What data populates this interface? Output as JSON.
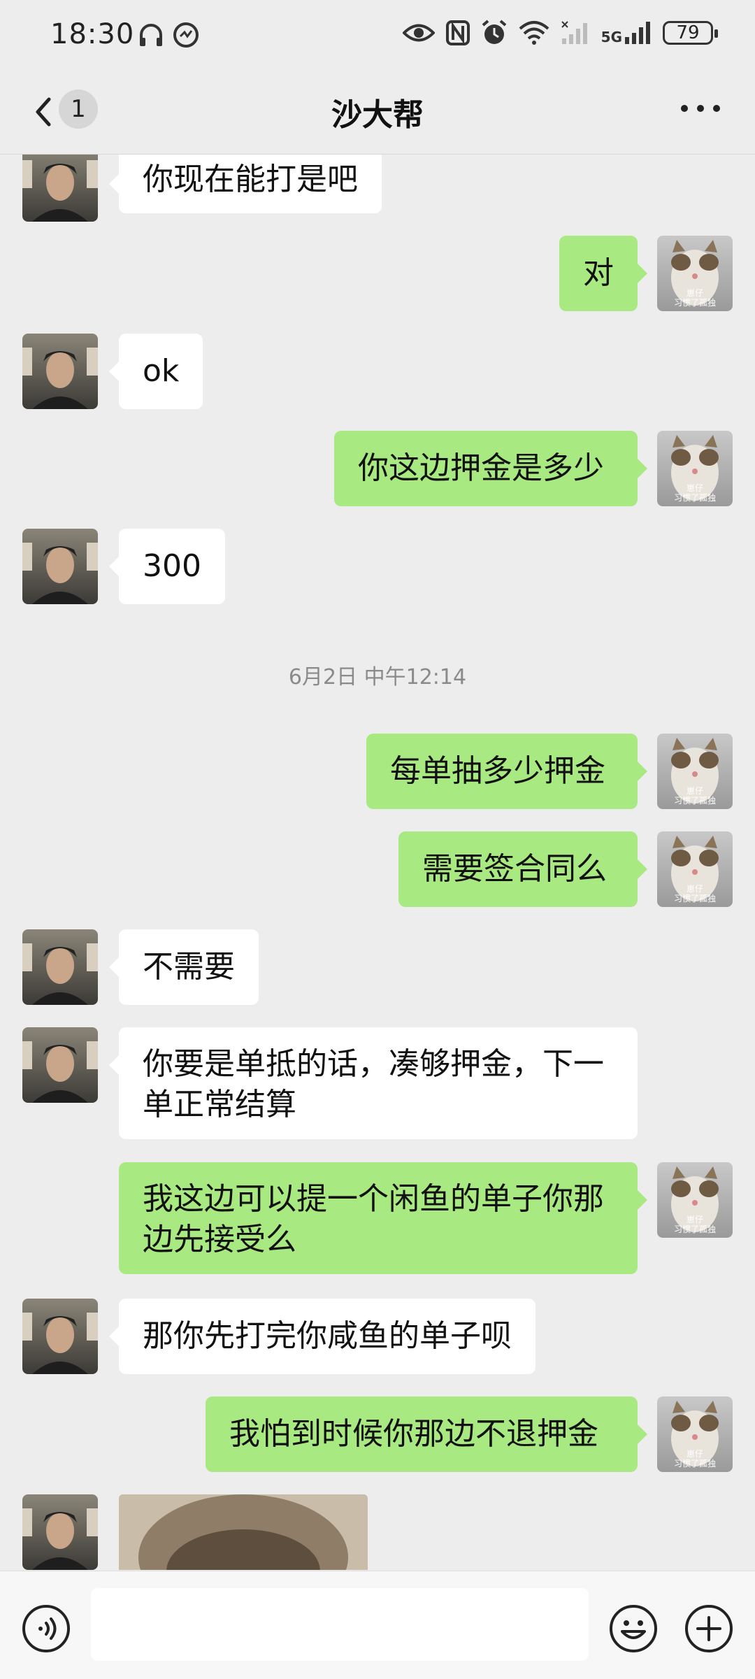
{
  "status_bar": {
    "time": "18:30",
    "battery": "79",
    "network": "5G"
  },
  "header": {
    "unread_count": "1",
    "title": "沙大帮"
  },
  "messages": [
    {
      "side": "in",
      "text": "你现在能打是吧"
    },
    {
      "side": "out",
      "text": "对"
    },
    {
      "side": "in",
      "text": "ok"
    },
    {
      "side": "out",
      "text": "你这边押金是多少"
    },
    {
      "side": "in",
      "text": "300"
    },
    {
      "side": "time",
      "text": "6月2日 中午12:14"
    },
    {
      "side": "out",
      "text": "每单抽多少押金"
    },
    {
      "side": "out",
      "text": "需要签合同么"
    },
    {
      "side": "in",
      "text": "不需要"
    },
    {
      "side": "in",
      "text": "你要是单抵的话，凑够押金，下一单正常结算"
    },
    {
      "side": "out",
      "text": "我这边可以提一个闲鱼的单子你那边先接受么"
    },
    {
      "side": "in",
      "text": "那你先打完你咸鱼的单子呗"
    },
    {
      "side": "out",
      "text": "我怕到时候你那边不退押金"
    },
    {
      "side": "in",
      "text": ""
    }
  ],
  "self_avatar_caption": [
    "崽仔",
    "习惯了孤独"
  ],
  "input": {
    "value": ""
  },
  "colors": {
    "background": "#ededed",
    "incoming_bubble": "#ffffff",
    "outgoing_bubble": "#a9e982"
  }
}
